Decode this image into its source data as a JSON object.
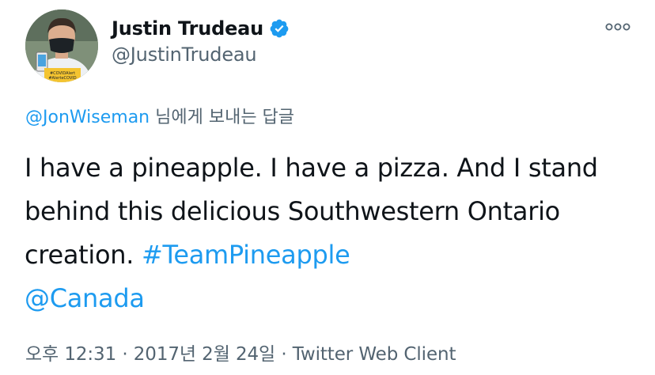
{
  "author": {
    "display_name": "Justin Trudeau",
    "handle": "@JustinTrudeau",
    "verified": true,
    "avatar_badge_line1": "#COVIDAlert",
    "avatar_badge_line2": "#AlerteCOVID"
  },
  "reply_context": {
    "mention": "@JonWiseman",
    "suffix": " 님에게 보내는 답글"
  },
  "tweet": {
    "text_plain": "I have a pineapple. I have a pizza. And I stand behind this delicious Southwestern Ontario creation. ",
    "hashtag": "#TeamPineapple",
    "mention": "@Canada"
  },
  "meta": {
    "time": "오후 12:31",
    "separator1": " · ",
    "date": "2017년 2월 24일",
    "separator2": " · ",
    "client": "Twitter Web Client"
  },
  "icons": {
    "more": "more-horizontal-icon",
    "verified": "verified-badge-icon"
  },
  "colors": {
    "link": "#1d9bf0",
    "secondary_text": "#536471",
    "primary_text": "#0f1419",
    "verified_badge": "#1d9bf0"
  }
}
